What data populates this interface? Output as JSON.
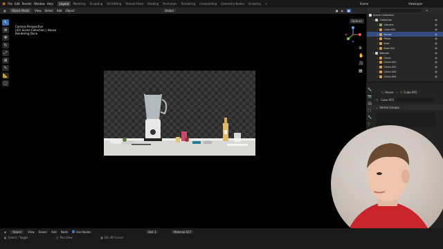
{
  "topbar": {
    "menus": [
      "File",
      "Edit",
      "Render",
      "Window",
      "Help"
    ],
    "tabs": [
      "Layout",
      "Modeling",
      "Sculpting",
      "UV Editing",
      "Texture Paint",
      "Shading",
      "Animation",
      "Rendering",
      "Compositing",
      "Geometry Nodes",
      "Scripting"
    ],
    "active_tab": "Layout",
    "scene": "Scene",
    "view_layer": "ViewLayer"
  },
  "viewport_header": {
    "mode": "Object Mode",
    "menus": [
      "View",
      "Select",
      "Add",
      "Object"
    ],
    "orientation": "Global",
    "options": "Options"
  },
  "viewport_info": {
    "line1": "Camera Perspective",
    "line2": "(42) Scene Collection | House",
    "line3": "Rendering Done"
  },
  "outliner": {
    "root": "Scene Collection",
    "rows": [
      {
        "label": "Collection",
        "indent": 1,
        "color": "#cfcfcf"
      },
      {
        "label": "Camera",
        "indent": 2,
        "color": "#88aa66"
      },
      {
        "label": "Cube.001",
        "indent": 2,
        "color": "#e0a050"
      },
      {
        "label": "House",
        "indent": 2,
        "color": "#e0a050",
        "selected": true
      },
      {
        "label": "Plane",
        "indent": 2,
        "color": "#e0a050"
      },
      {
        "label": "Knot",
        "indent": 2,
        "color": "#e0a050"
      },
      {
        "label": "Knot.001",
        "indent": 2,
        "color": "#e0a050"
      },
      {
        "label": "Blender",
        "indent": 1,
        "color": "#cfcfcf"
      },
      {
        "label": "Circle",
        "indent": 2,
        "color": "#e0a050"
      },
      {
        "label": "Circle.001",
        "indent": 2,
        "color": "#e0a050"
      },
      {
        "label": "Circle.002",
        "indent": 2,
        "color": "#e0a050"
      },
      {
        "label": "Circle.003",
        "indent": 2,
        "color": "#e0a050"
      },
      {
        "label": "Circle.004",
        "indent": 2,
        "color": "#e0a050"
      }
    ]
  },
  "properties": {
    "breadcrumb_object": "House",
    "breadcrumb_data": "Cube.001",
    "data_field": "Cube.001",
    "section": "Vertex Groups"
  },
  "statusbar": {
    "row1": [
      "Object",
      "View",
      "Select",
      "Add",
      "Node",
      "Use Nodes"
    ],
    "slot": "Slot 1",
    "material": "Material.027",
    "row2_left": "Select / Toggle",
    "row2_mid": "Pan View",
    "row2_right": "Set 3D Cursor"
  },
  "colors": {
    "accent": "#3d6fb5",
    "selection": "#334d80"
  }
}
